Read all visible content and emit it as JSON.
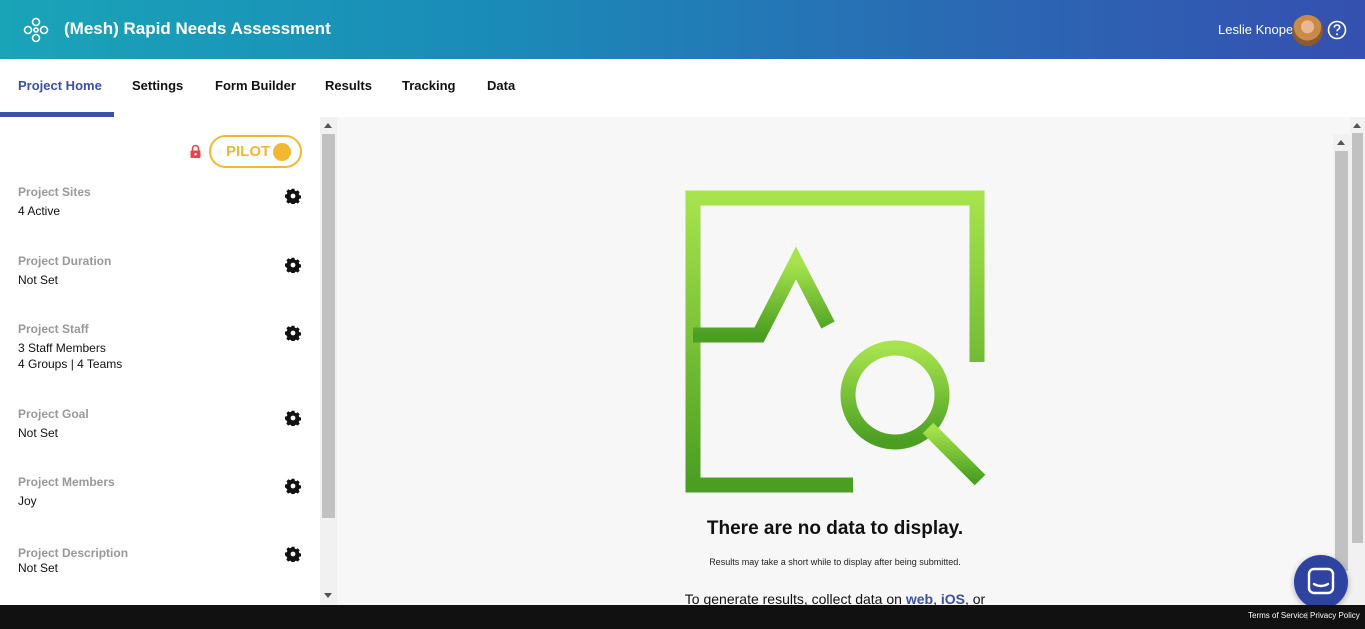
{
  "header": {
    "title": "(Mesh) Rapid Needs Assessment",
    "user_name": "Leslie Knope",
    "logo_icon": "mesh-logo-icon",
    "help_icon": "help-circle-icon"
  },
  "tabs": [
    {
      "label": "Project Home",
      "active": true
    },
    {
      "label": "Settings",
      "active": false
    },
    {
      "label": "Form Builder",
      "active": false
    },
    {
      "label": "Results",
      "active": false
    },
    {
      "label": "Tracking",
      "active": false
    },
    {
      "label": "Data",
      "active": false
    }
  ],
  "sidebar": {
    "status_badge": "PILOT",
    "settings": [
      {
        "label": "Project Sites",
        "value": "4 Active",
        "value2": ""
      },
      {
        "label": "Project Duration",
        "value": "Not Set",
        "value2": ""
      },
      {
        "label": "Project Staff",
        "value": "3 Staff Members",
        "value2": "4 Groups | 4 Teams"
      },
      {
        "label": "Project Goal",
        "value": "Not Set",
        "value2": ""
      },
      {
        "label": "Project Members",
        "value": "Joy",
        "value2": ""
      },
      {
        "label": "Project Description",
        "value": "Not Set",
        "value2": ""
      }
    ]
  },
  "main": {
    "empty_title": "There are no data to display.",
    "empty_subtitle": "Results may take a short while to display after being submitted.",
    "empty_more_prefix": "To generate results, collect data on ",
    "link_web": "web",
    "sep": ", ",
    "link_ios": "iOS",
    "empty_more_suffix": ", or"
  },
  "footer": {
    "terms": "Terms of Service",
    "separator": "|",
    "privacy": "Privacy Policy"
  },
  "colors": {
    "accent": "#3a4fa8",
    "pilot": "#f5b731",
    "illustration_top": "#a6e34d",
    "illustration_bottom": "#4a9e22"
  }
}
